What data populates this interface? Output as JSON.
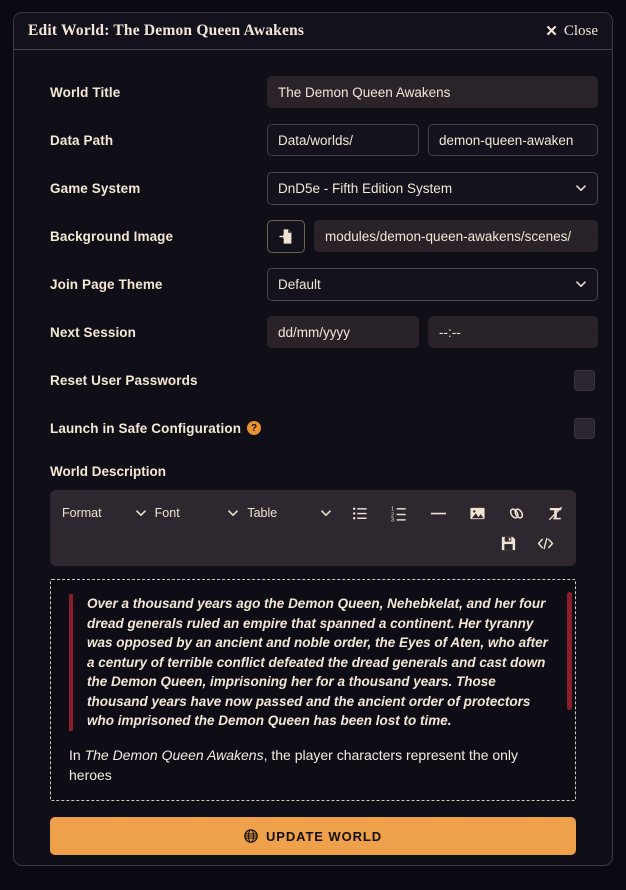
{
  "dialog": {
    "title": "Edit World: The Demon Queen Awakens",
    "close_label": "Close",
    "close_icon": "close-x-icon"
  },
  "form": {
    "world_title": {
      "label": "World Title",
      "value": "The Demon Queen Awakens"
    },
    "data_path": {
      "label": "Data Path",
      "prefix_value": "Data/worlds/",
      "slug_value": "demon-queen-awaken"
    },
    "game_system": {
      "label": "Game System",
      "selected": "DnD5e - Fifth Edition System",
      "chevron_icon": "chevron-down-icon"
    },
    "background_image": {
      "label": "Background Image",
      "picker_icon": "file-import-icon",
      "value": "modules/demon-queen-awakens/scenes/"
    },
    "join_page_theme": {
      "label": "Join Page Theme",
      "selected": "Default",
      "chevron_icon": "chevron-down-icon"
    },
    "next_session": {
      "label": "Next Session",
      "date_placeholder": "dd/mm/yyyy",
      "time_placeholder": "--:--"
    },
    "reset_user_passwords": {
      "label": "Reset User Passwords",
      "checked": false
    },
    "launch_safe_config": {
      "label": "Launch in Safe Configuration",
      "help_glyph": "?",
      "checked": false
    },
    "world_description": {
      "label": "World Description"
    }
  },
  "toolbar": {
    "format_label": "Format",
    "font_label": "Font",
    "table_label": "Table",
    "chevron_icon": "chevron-down-icon",
    "icons": [
      "bullet-list-icon",
      "numbered-list-icon",
      "horizontal-rule-icon",
      "image-icon",
      "link-icon",
      "clear-format-icon"
    ],
    "row2_icons": [
      "save-icon",
      "source-code-icon"
    ]
  },
  "editor": {
    "quote_text": "Over a thousand years ago the Demon Queen, Nehebkelat, and her four dread generals ruled an empire that spanned a continent. Her tyranny was opposed by an ancient and noble order, the Eyes of Aten, who after a century of terrible conflict defeated the dread generals and cast down the Demon Queen, imprisoning her for a thousand years. Those thousand years have now passed and the ancient order of protectors who imprisoned the Demon Queen has been lost to time.",
    "paragraph_lead": "In ",
    "paragraph_italic": "The Demon Queen Awakens",
    "paragraph_rest": ", the player characters represent the only heroes"
  },
  "footer": {
    "update_label": "UPDATE WORLD",
    "update_icon": "globe-icon"
  },
  "colors": {
    "accent": "#eea04a",
    "quote_bar": "#8c1d2b",
    "label_text": "#f4e7d3",
    "dialog_bg": "#100f18"
  }
}
